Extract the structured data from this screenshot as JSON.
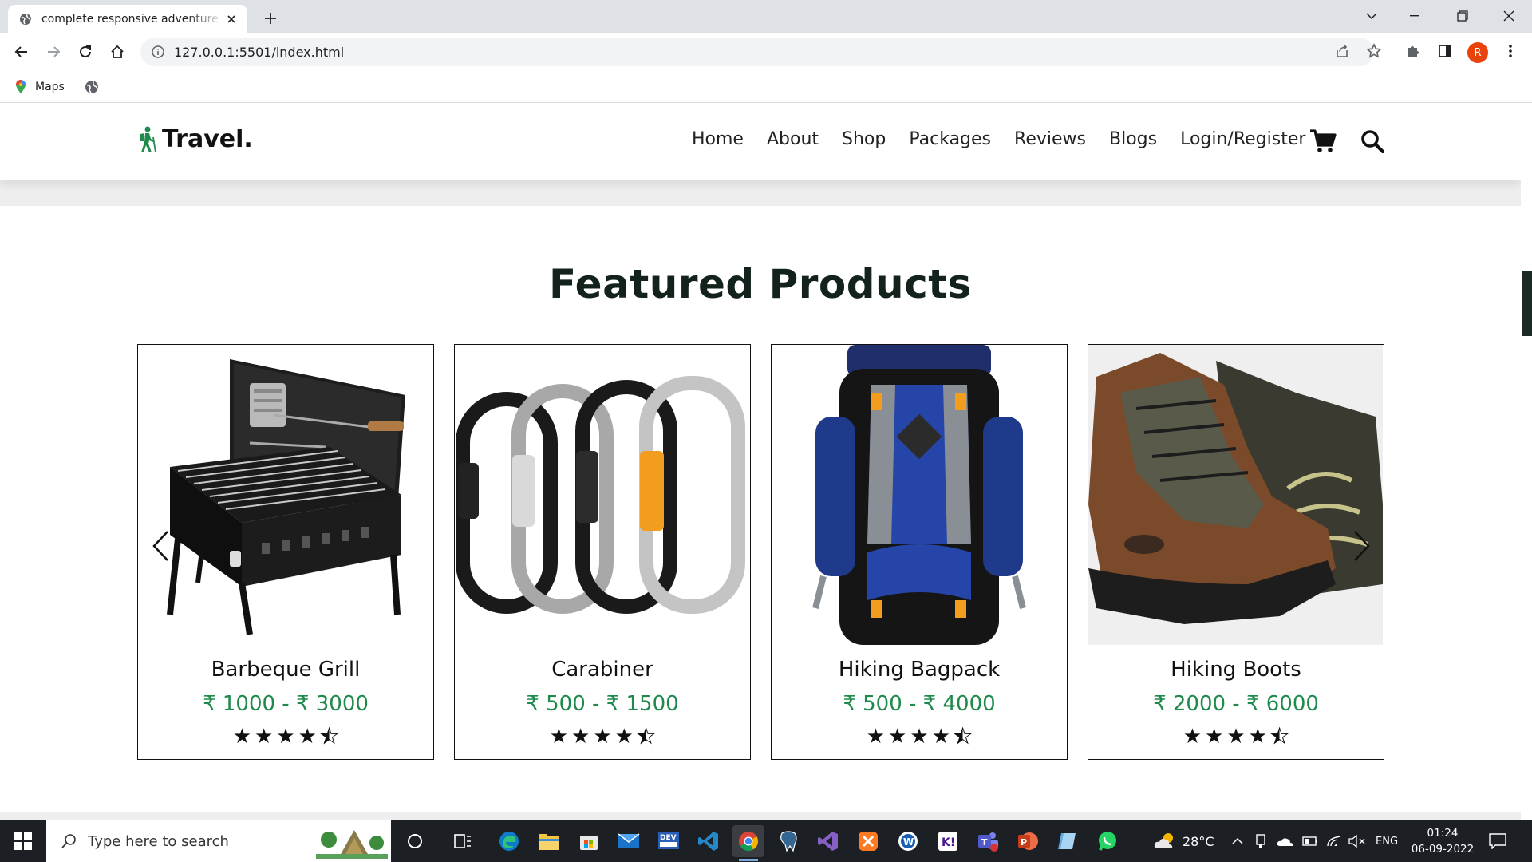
{
  "browser": {
    "tab_title": "complete responsive adventure & travel",
    "url": "127.0.0.1:5501/index.html",
    "bookmarks": [
      "Maps"
    ],
    "profile_initial": "R"
  },
  "site": {
    "logo_text": "Travel.",
    "nav": [
      "Home",
      "About",
      "Shop",
      "Packages",
      "Reviews",
      "Blogs",
      "Login/Register"
    ],
    "section_title": "Featured Products",
    "products": [
      {
        "name": "Barbeque Grill",
        "price": "₹ 1000 - ₹ 3000",
        "rating": 4.5,
        "image": "barbeque-grill-image"
      },
      {
        "name": "Carabiner",
        "price": "₹ 500 - ₹ 1500",
        "rating": 4.5,
        "image": "carabiner-image"
      },
      {
        "name": "Hiking Bagpack",
        "price": "₹ 500 - ₹ 4000",
        "rating": 4.5,
        "image": "backpack-image"
      },
      {
        "name": "Hiking Boots",
        "price": "₹ 2000 - ₹ 6000",
        "rating": 4.5,
        "image": "hiking-boots-image"
      }
    ]
  },
  "taskbar": {
    "search_placeholder": "Type here to search",
    "weather": "28°C",
    "language": "ENG",
    "time": "01:24",
    "date": "06-09-2022"
  },
  "colors": {
    "accent_green": "#1f8a4c",
    "heading": "#13231c",
    "taskbar": "#1c1f24",
    "chrome_tabs": "#dee1e6"
  }
}
